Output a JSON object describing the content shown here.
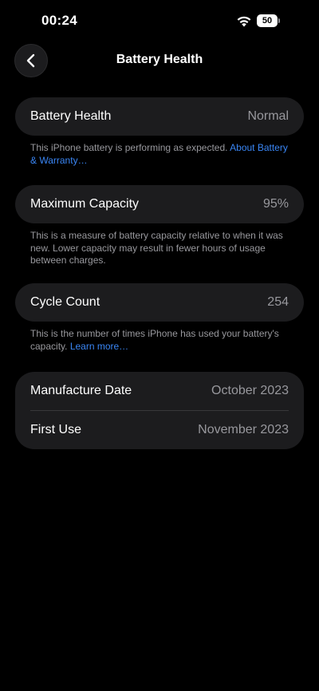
{
  "status_bar": {
    "time": "00:24",
    "battery_level": "50"
  },
  "nav": {
    "title": "Battery Health"
  },
  "sections": {
    "health": {
      "label": "Battery Health",
      "value": "Normal",
      "footnote": "This iPhone battery is performing as expected. ",
      "link": "About Battery & Warranty…"
    },
    "capacity": {
      "label": "Maximum Capacity",
      "value": "95%",
      "footnote": "This is a measure of battery capacity relative to when it was new. Lower capacity may result in fewer hours of usage between charges."
    },
    "cycles": {
      "label": "Cycle Count",
      "value": "254",
      "footnote": "This is the number of times iPhone has used your battery's capacity. ",
      "link": "Learn more…"
    },
    "dates": {
      "manufacture_label": "Manufacture Date",
      "manufacture_value": "October 2023",
      "first_use_label": "First Use",
      "first_use_value": "November 2023"
    }
  },
  "colors": {
    "background": "#000000",
    "card": "#1c1c1e",
    "secondary_text": "#98989d",
    "link": "#3a86f5"
  }
}
